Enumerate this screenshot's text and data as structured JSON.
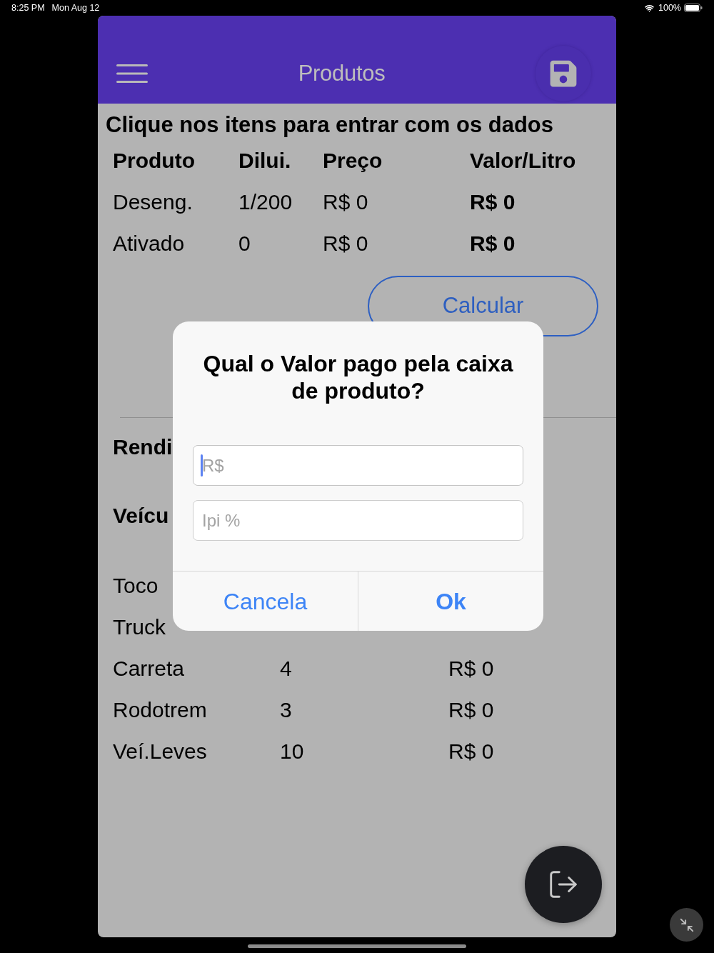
{
  "status_bar": {
    "time": "8:25 PM",
    "date": "Mon Aug 12",
    "battery": "100%"
  },
  "header": {
    "title": "Produtos"
  },
  "instructions": "Clique nos itens para entrar com os dados",
  "products_table": {
    "columns": [
      "Produto",
      "Dilui.",
      "Preço",
      "Valor/Litro"
    ],
    "rows": [
      {
        "cells": [
          "Deseng.",
          "1/200",
          "R$ 0",
          "R$ 0"
        ]
      },
      {
        "cells": [
          "Ativado",
          "0",
          "R$ 0",
          "R$ 0"
        ]
      }
    ]
  },
  "calculate_button": "Calcular",
  "section_headings": [
    "Rendi",
    "Veícu"
  ],
  "vehicles": [
    {
      "cells": [
        "Toco"
      ]
    },
    {
      "cells": [
        "Truck"
      ]
    },
    {
      "cells": [
        "Carreta",
        "4",
        "R$ 0"
      ]
    },
    {
      "cells": [
        "Rodotrem",
        "3",
        "R$ 0"
      ]
    },
    {
      "cells": [
        "Veí.Leves",
        "10",
        "R$ 0"
      ]
    }
  ],
  "dialog": {
    "title": "Qual o Valor pago pela caixa de produto?",
    "fields": [
      {
        "placeholder": "R$",
        "focused": true
      },
      {
        "placeholder": "Ipi %",
        "focused": false
      }
    ],
    "buttons": [
      {
        "label": "Cancela",
        "kind": "cancel"
      },
      {
        "label": "Ok",
        "kind": "confirm"
      }
    ]
  }
}
